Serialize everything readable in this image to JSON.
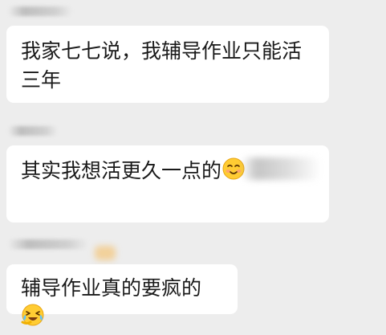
{
  "messages": [
    {
      "text": "我家七七说，我辅导作业只能活三年",
      "emoji": null
    },
    {
      "text": "其实我想活更久一点的",
      "emoji": "smiling-face-icon"
    },
    {
      "text": "辅导作业真的要疯的",
      "emoji": "crying-laughing-face-icon"
    }
  ]
}
